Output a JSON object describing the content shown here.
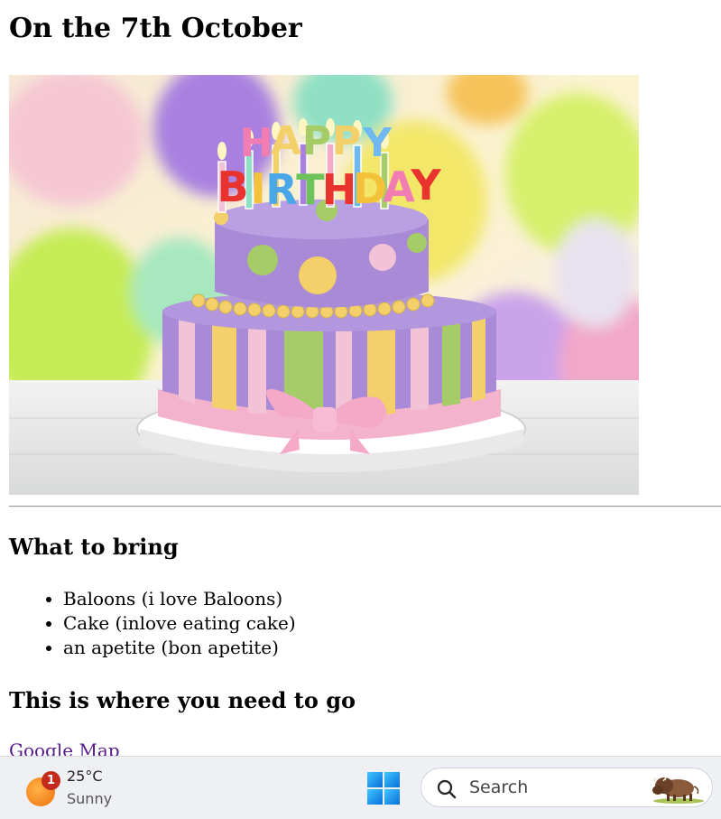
{
  "page": {
    "title": "On the 7th October",
    "image_alt": "Happy Birthday cake",
    "cake_candles_text": "HAPPY BIRTHDAY",
    "bring_heading": "What to bring",
    "bring_items": [
      "Baloons (i love Baloons)",
      "Cake (inlove eating cake)",
      "an apetite (bon apetite)"
    ],
    "go_heading": "This is where you need to go",
    "map_link": "Google Map"
  },
  "taskbar": {
    "weather": {
      "temperature": "25°C",
      "condition": "Sunny",
      "badge_count": "1",
      "icon": "sun-icon"
    },
    "start_icon": "windows-logo-icon",
    "search": {
      "placeholder": "Search",
      "icon": "search-icon",
      "decoration_icon": "bison-icon"
    }
  },
  "colors": {
    "link_visited": "#551a8b",
    "taskbar_bg": "#eef0f4",
    "badge_red": "#c42b1c",
    "windows_blue": "#1e90ff"
  }
}
